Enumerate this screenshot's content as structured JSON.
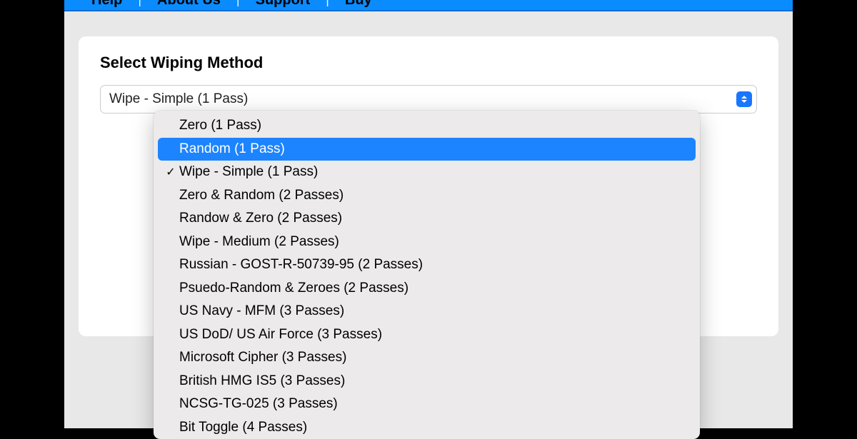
{
  "menu": {
    "items": [
      "Help",
      "About Us",
      "Support",
      "Buy"
    ]
  },
  "section": {
    "title": "Select Wiping Method"
  },
  "select": {
    "value": "Wipe - Simple (1 Pass)"
  },
  "dropdown": {
    "selected_index": 2,
    "highlight_index": 1,
    "options": [
      "Zero (1 Pass)",
      "Random (1 Pass)",
      "Wipe - Simple (1 Pass)",
      "Zero & Random (2 Passes)",
      "Randow & Zero (2 Passes)",
      "Wipe - Medium (2 Passes)",
      "Russian - GOST-R-50739-95 (2 Passes)",
      "Psuedo-Random & Zeroes (2 Passes)",
      "US Navy - MFM (3 Passes)",
      "US DoD/ US Air Force (3 Passes)",
      "Microsoft Cipher (3 Passes)",
      "British HMG IS5 (3 Passes)",
      "NCSG-TG-025 (3 Passes)",
      "Bit Toggle (4 Passes)"
    ]
  },
  "icons": {
    "check": "✓"
  }
}
